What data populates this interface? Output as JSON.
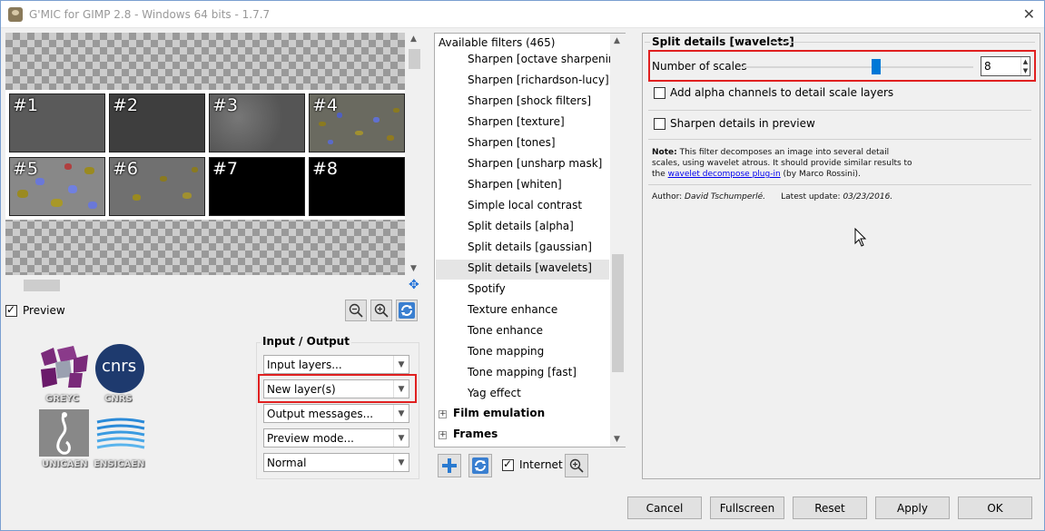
{
  "window": {
    "title": "G'MIC for GIMP 2.8 - Windows 64 bits - 1.7.7"
  },
  "preview": {
    "thumbnails": [
      "#1",
      "#2",
      "#3",
      "#4",
      "#5",
      "#6",
      "#7",
      "#8"
    ],
    "checkbox_label": "Preview",
    "checked": true
  },
  "logos": {
    "greyc": "GREYC",
    "cnrs": "CNRS",
    "cnrs_mark": "cnrs",
    "unicaen": "UNICAEN",
    "ensicaen": "ENSICAEN"
  },
  "io": {
    "title": "Input / Output",
    "input_layers": "Input layers...",
    "output_mode": "New layer(s)",
    "output_messages": "Output messages...",
    "preview_mode": "Preview mode...",
    "blend": "Normal"
  },
  "filters": {
    "header": "Available filters (465)",
    "items": [
      "Sharpen [octave sharpening]",
      "Sharpen [richardson-lucy]",
      "Sharpen [shock filters]",
      "Sharpen [texture]",
      "Sharpen [tones]",
      "Sharpen [unsharp mask]",
      "Sharpen [whiten]",
      "Simple local contrast",
      "Split details [alpha]",
      "Split details [gaussian]",
      "Split details [wavelets]",
      "Spotify",
      "Texture enhance",
      "Tone enhance",
      "Tone mapping",
      "Tone mapping [fast]",
      "Yag effect"
    ],
    "selected_index": 10,
    "categories": [
      "Film emulation",
      "Frames"
    ],
    "internet_label": "Internet",
    "internet_checked": true
  },
  "params": {
    "title": "Split details [wavelets]",
    "scales_label": "Number of scales",
    "scales_value": "8",
    "scales_fraction": 0.58,
    "alpha_label": "Add alpha channels to detail scale layers",
    "sharpen_label": "Sharpen details in preview",
    "note_bold": "Note:",
    "note_text1": " This filter decomposes an image into several detail scales, using wavelet atrous. It should provide similar results to the ",
    "note_link": "wavelet decompose plug-in",
    "note_text2": " (by Marco Rossini).",
    "author_label": "Author: ",
    "author_name": "David Tschumperlé.",
    "update_label": "Latest update: ",
    "update_date": "03/23/2016."
  },
  "buttons": {
    "cancel": "Cancel",
    "fullscreen": "Fullscreen",
    "reset": "Reset",
    "apply": "Apply",
    "ok": "OK"
  },
  "colors": {
    "accent": "#0078d7",
    "highlight": "#e02020"
  }
}
